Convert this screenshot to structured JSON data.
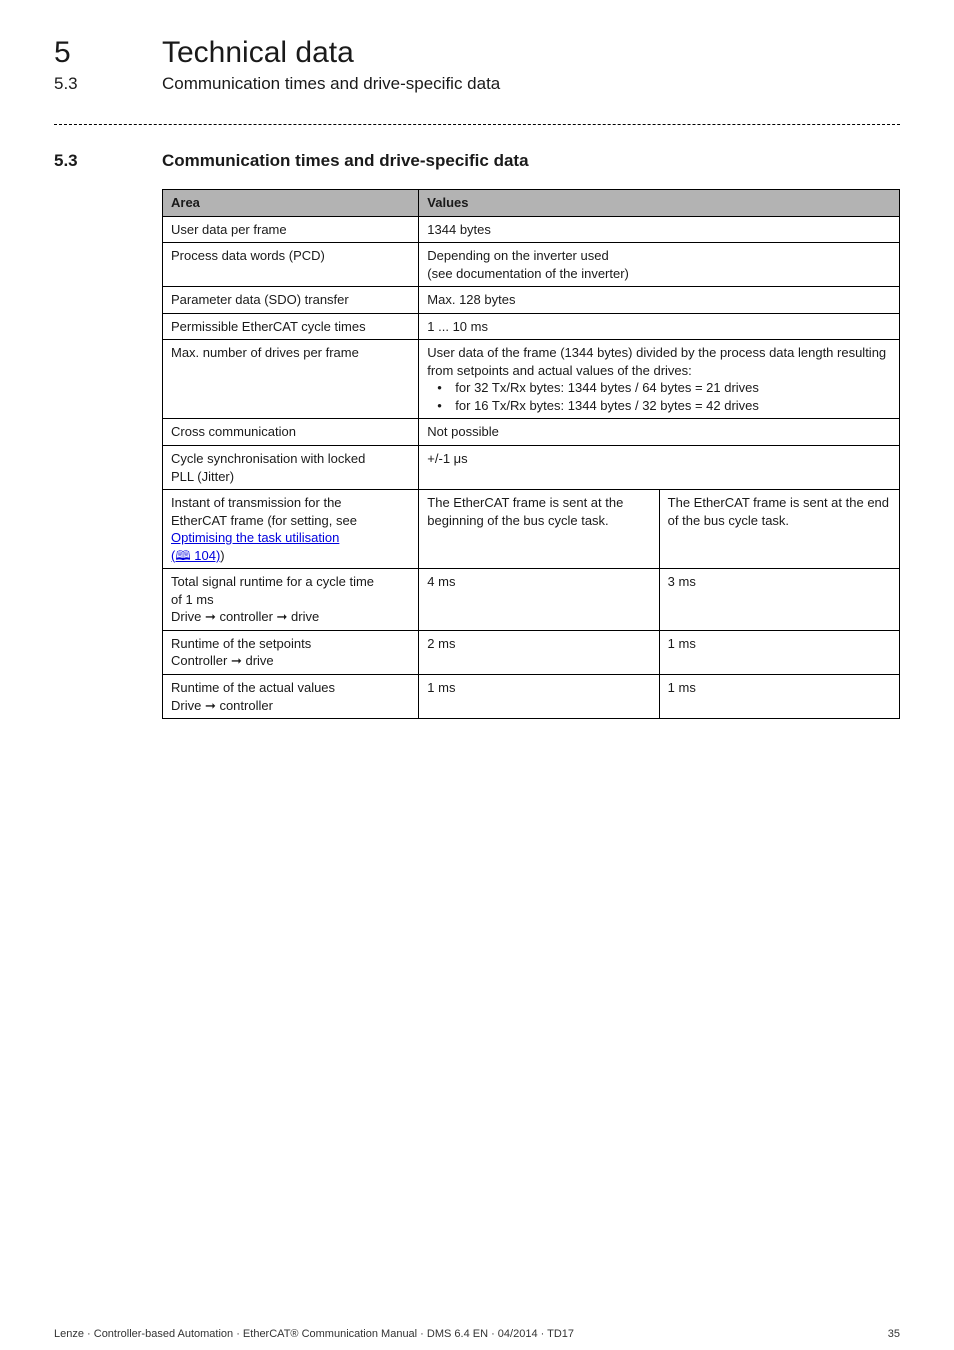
{
  "chapter": {
    "num": "5",
    "title": "Technical data"
  },
  "subchapter": {
    "num": "5.3",
    "title": "Communication times and drive-specific data"
  },
  "section_heading": {
    "num": "5.3",
    "title": "Communication times and drive-specific data"
  },
  "table": {
    "head": {
      "area": "Area",
      "values": "Values"
    },
    "rows": [
      {
        "area": "User data per frame",
        "values": "1344 bytes"
      },
      {
        "area": "Process data words (PCD)",
        "values_line1": "Depending on the inverter used",
        "values_line2": "(see documentation of the inverter)"
      },
      {
        "area": "Parameter data (SDO) transfer",
        "values": "Max. 128 bytes"
      },
      {
        "area": "Permissible EtherCAT cycle times",
        "values": "1 ... 10 ms"
      },
      {
        "area": "Max. number of drives per frame",
        "values_line1": "User data of the frame (1344 bytes) divided by the process data length resulting from setpoints and actual values of the drives:",
        "bullet1": "for 32 Tx/Rx bytes: 1344 bytes / 64 bytes = 21 drives",
        "bullet2": "for 16 Tx/Rx bytes: 1344 bytes / 32 bytes = 42 drives"
      },
      {
        "area": "Cross communication",
        "values": "Not possible"
      },
      {
        "area_line1": "Cycle synchronisation with locked",
        "area_line2": "PLL (Jitter)",
        "values": "+/-1 μs"
      },
      {
        "area_line1": "Instant of transmission for the",
        "area_line2": "EtherCAT frame (for setting, see",
        "area_link": "Optimising the task utilisation",
        "area_pageref": "(🕮 104)",
        "area_closeparen": ")",
        "left": "The EtherCAT frame is sent at the beginning of the bus cycle task.",
        "right": "The EtherCAT frame is sent at the end of the bus cycle task."
      },
      {
        "area_line1": "Total signal runtime for a cycle time",
        "area_line2": "of 1 ms",
        "area_line3": "Drive ➞ controller ➞ drive",
        "left": "4 ms",
        "right": "3 ms"
      },
      {
        "area_line1": "Runtime of the setpoints",
        "area_line2": "Controller ➞ drive",
        "left": "2 ms",
        "right": "1 ms"
      },
      {
        "area_line1": "Runtime of the actual values",
        "area_line2": "Drive ➞ controller",
        "left": "1 ms",
        "right": "1 ms"
      }
    ]
  },
  "footer": {
    "left": "Lenze · Controller-based Automation · EtherCAT® Communication Manual · DMS 6.4 EN · 04/2014 · TD17",
    "page": "35"
  }
}
